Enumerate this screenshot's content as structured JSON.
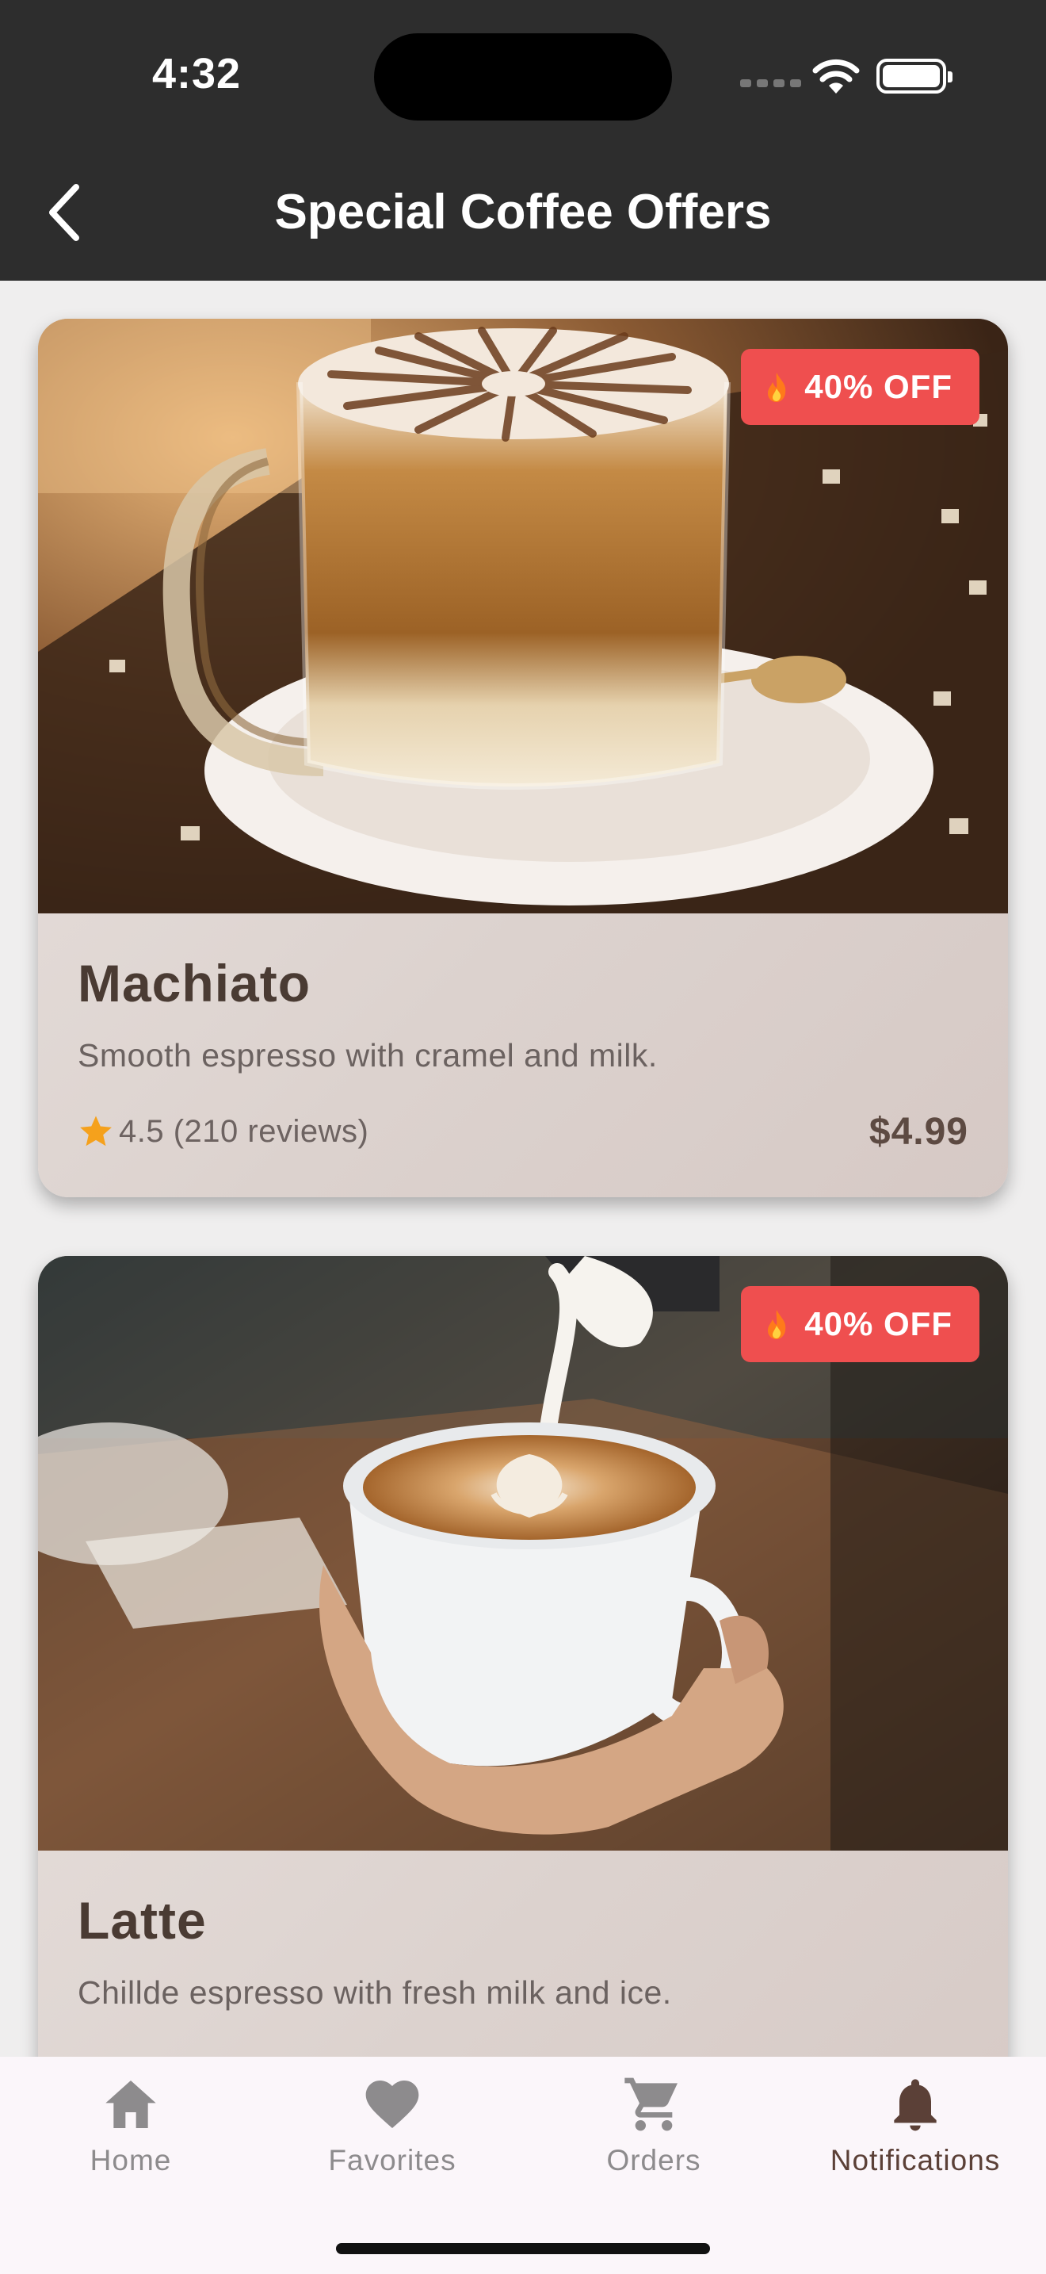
{
  "status_bar": {
    "time": "4:32"
  },
  "header": {
    "title": "Special Coffee Offers"
  },
  "offers": [
    {
      "badge": "40% OFF",
      "name": "Machiato",
      "description": "Smooth espresso with cramel and milk.",
      "rating": "4.5 (210 reviews)",
      "price": "$4.99"
    },
    {
      "badge": "40% OFF",
      "name": "Latte",
      "description": "Chillde espresso with fresh milk and ice."
    }
  ],
  "bottom_nav": {
    "items": [
      {
        "label": "Home",
        "icon": "home-icon"
      },
      {
        "label": "Favorites",
        "icon": "heart-icon"
      },
      {
        "label": "Orders",
        "icon": "cart-icon"
      },
      {
        "label": "Notifications",
        "icon": "bell-icon",
        "active": true
      }
    ]
  },
  "colors": {
    "header_bg": "#2d2d2d",
    "badge": "#ef4f4f",
    "accent_brown": "#5b4037",
    "star": "#f5a11c",
    "nav_bg": "#fbf6fa"
  }
}
